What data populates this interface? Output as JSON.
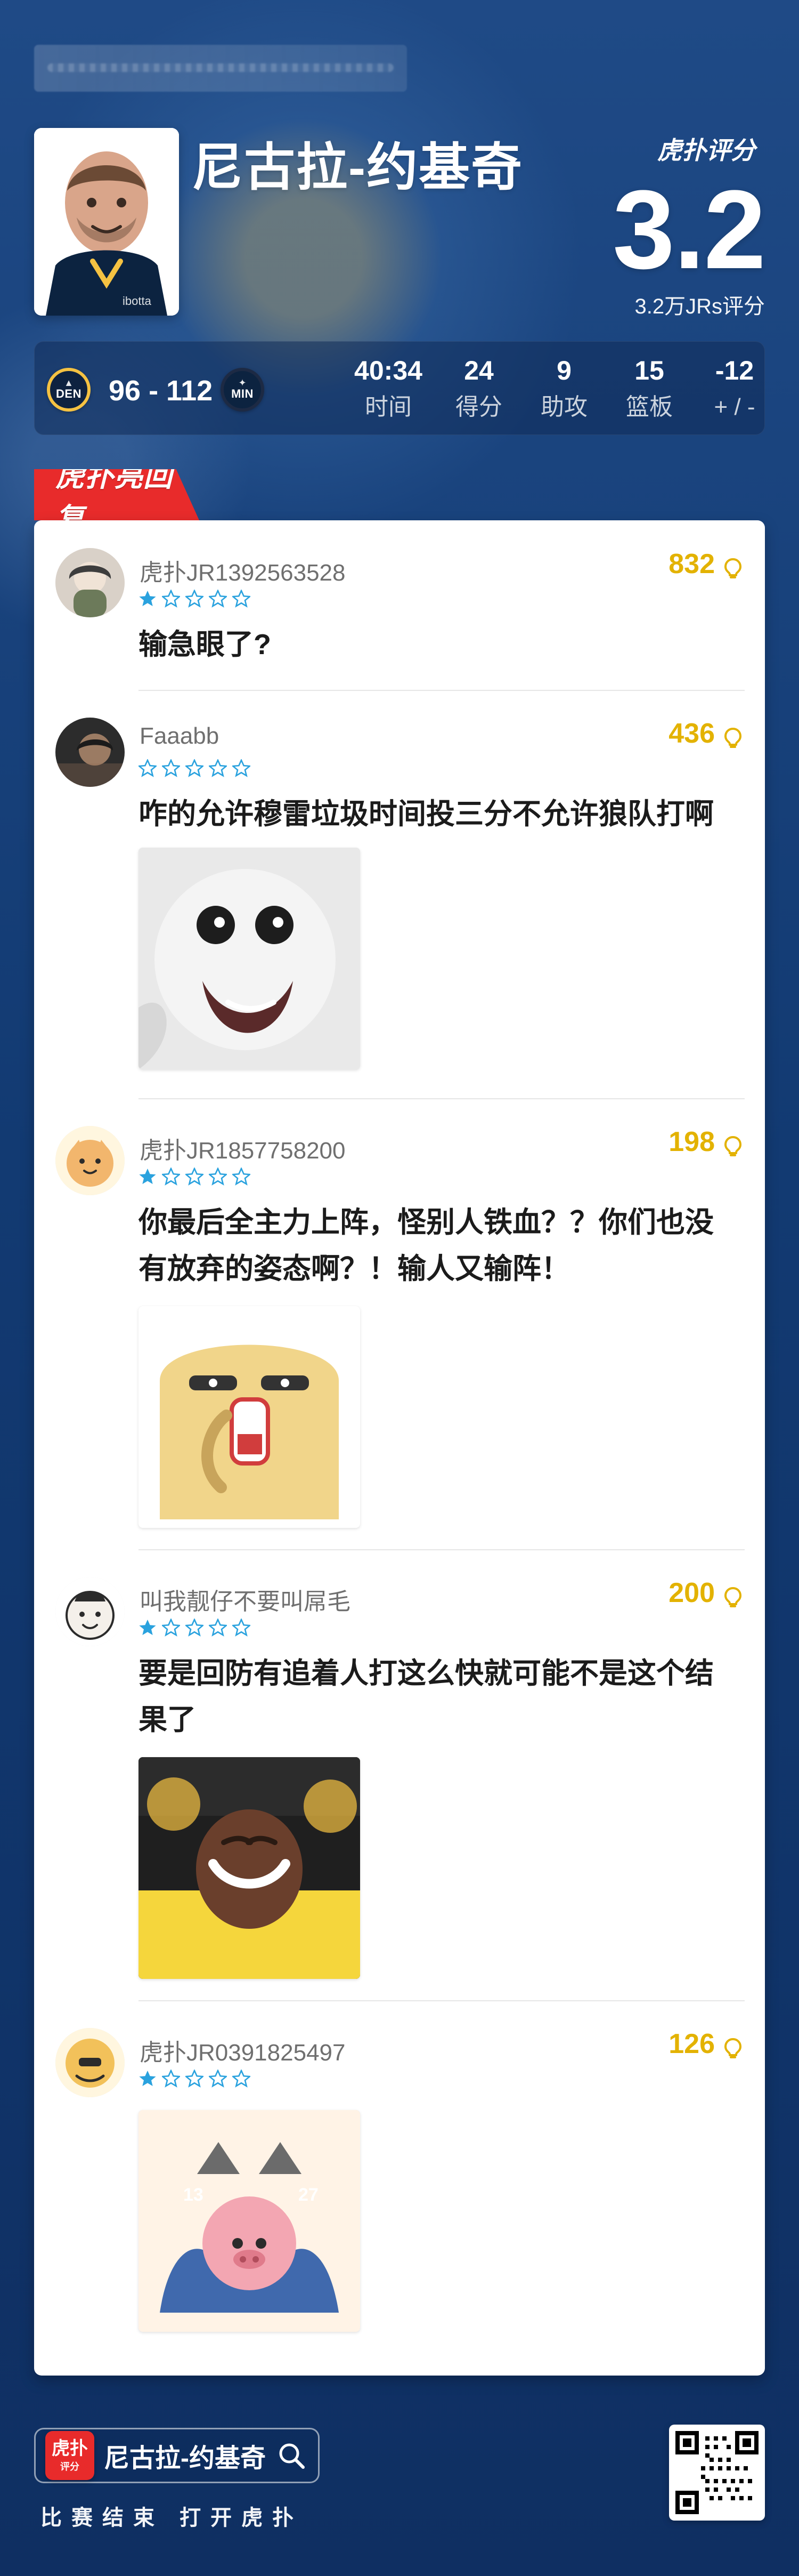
{
  "header": {
    "player_name": "尼古拉-约基奇",
    "brand_label": "虎扑评分",
    "score": "3.2",
    "votes": "3.2万JRs评分"
  },
  "stats": {
    "home_abbr": "DEN",
    "away_abbr": "MIN",
    "game_score": "96 - 112",
    "items": [
      {
        "value": "40:34",
        "label": "时间"
      },
      {
        "value": "24",
        "label": "得分"
      },
      {
        "value": "9",
        "label": "助攻"
      },
      {
        "value": "15",
        "label": "篮板"
      },
      {
        "value": "-12",
        "label": "+ / -"
      }
    ]
  },
  "section": {
    "title": "虎扑亮回复"
  },
  "comments": [
    {
      "user": "虎扑JR1392563528",
      "likes": "832",
      "stars": 1,
      "text": "输急眼了?"
    },
    {
      "user": "Faaabb",
      "likes": "436",
      "stars": 0,
      "text": "咋的允许穆雷垃圾时间投三分不允许狼队打啊"
    },
    {
      "user": "虎扑JR1857758200",
      "likes": "198",
      "stars": 1,
      "text": "你最后全主力上阵，怪别人铁血？？你们也没有放弃的姿态啊？！输人又输阵！"
    },
    {
      "user": "叫我靓仔不要叫屌毛",
      "likes": "200",
      "stars": 1,
      "text": "要是回防有追着人打这么快就可能不是这个结果了"
    },
    {
      "user": "虎扑JR0391825497",
      "likes": "126",
      "stars": 1,
      "text": ""
    }
  ],
  "bottom": {
    "search_text": "尼古拉-约基奇",
    "caption": "比赛结束 打开虎扑",
    "logo_main": "虎扑",
    "logo_sub": "评分"
  },
  "colors": {
    "accent_red": "#e82b2b",
    "like_gold": "#e3b200",
    "star_blue": "#2aa2de"
  },
  "icons": {
    "like": "lightbulb-icon",
    "star": "star-icon",
    "search": "search-icon",
    "qr": "qr-code"
  }
}
